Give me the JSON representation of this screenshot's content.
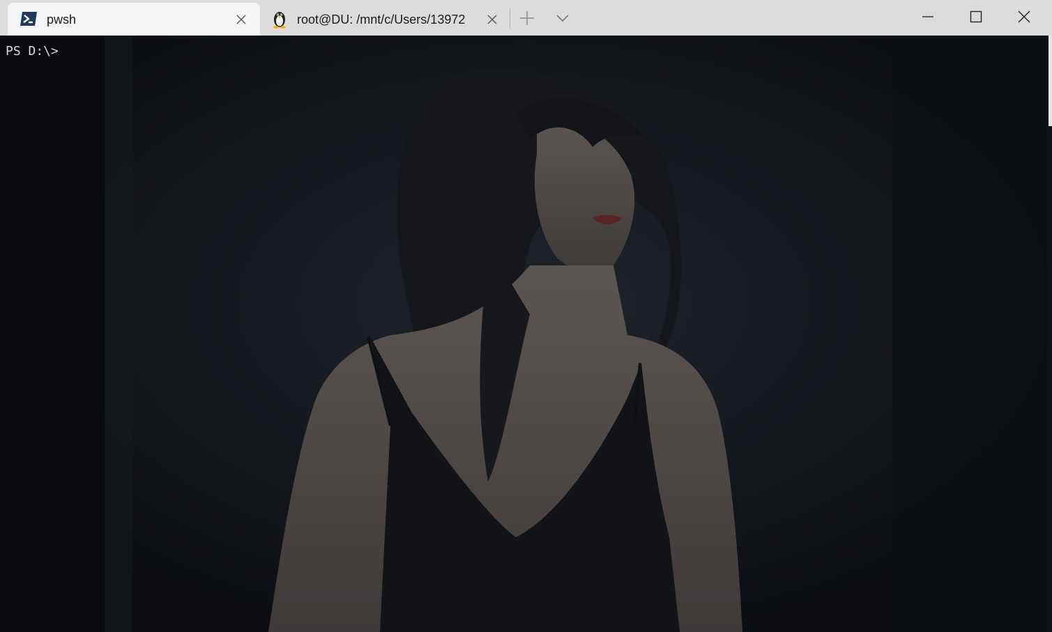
{
  "window": {
    "tabs": [
      {
        "title": "pwsh",
        "icon": "powershell-icon",
        "active": true
      },
      {
        "title": "root@DU: /mnt/c/Users/13972",
        "icon": "linux-penguin-icon",
        "active": false
      }
    ],
    "buttons": {
      "new_tab": "plus-icon",
      "dropdown": "chevron-down-icon",
      "minimize": "minimize-icon",
      "maximize": "maximize-icon",
      "close": "close-icon"
    }
  },
  "terminal": {
    "prompt": "PS D:\\>",
    "background": "dark illustrated wallpaper (woman in black dress)"
  },
  "colors": {
    "titlebar": "#dcdcdc",
    "active_tab": "#f6f6f6",
    "terminal_bg": "#0c0e12",
    "prompt_text": "#d8d8d8"
  }
}
